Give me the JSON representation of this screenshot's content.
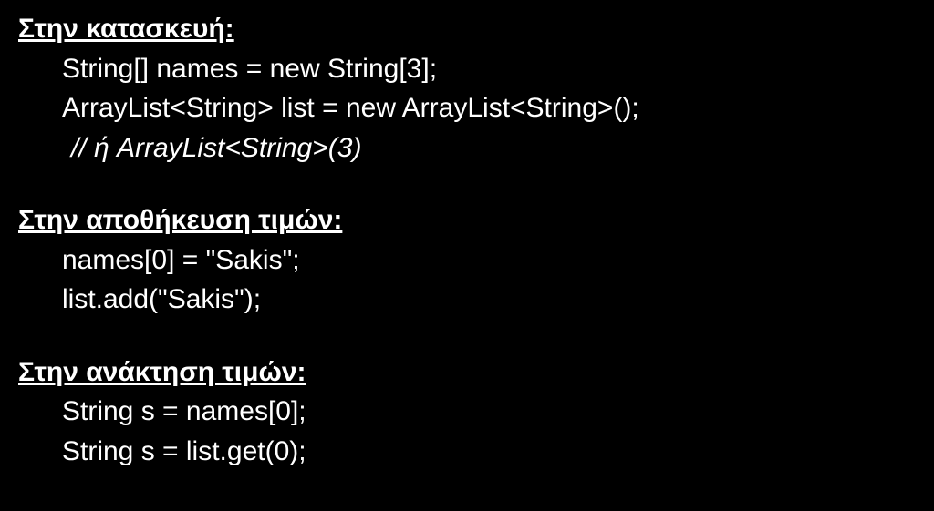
{
  "sections": {
    "construction": {
      "heading": "Στην κατασκευή:",
      "lines": [
        "String[] names = new String[3];",
        "ArrayList<String> list = new ArrayList<String>();"
      ],
      "comment": "// ή ArrayList<String>(3)"
    },
    "storage": {
      "heading": "Στην αποθήκευση τιμών:",
      "lines": [
        "names[0] = \"Sakis\";",
        "list.add(\"Sakis\");"
      ]
    },
    "retrieval": {
      "heading": "Στην ανάκτηση τιμών:",
      "lines": [
        "String s = names[0];",
        "String s = list.get(0);"
      ]
    }
  }
}
